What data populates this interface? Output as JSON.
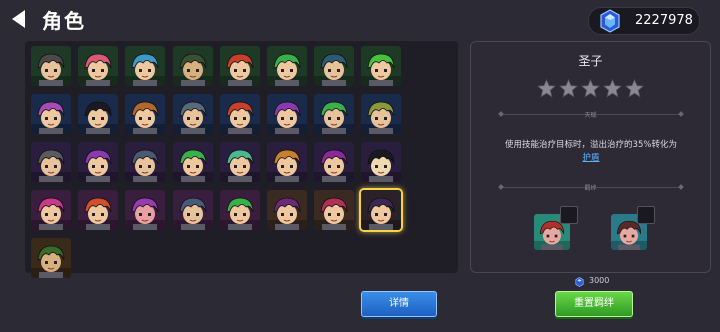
{
  "header": {
    "title": "角色",
    "currency_value": "2227978"
  },
  "roster": {
    "characters": [
      {
        "bg": "#1e3a26",
        "hair": "#4a4a4a",
        "skin": "#e8c29a"
      },
      {
        "bg": "#1e3a26",
        "hair": "#d85a78",
        "skin": "#f0c8a0"
      },
      {
        "bg": "#1e3a26",
        "hair": "#3a9ac8",
        "skin": "#f0c8a0"
      },
      {
        "bg": "#1e3a26",
        "hair": "#3a5030",
        "skin": "#d8b080"
      },
      {
        "bg": "#1e3a26",
        "hair": "#c8402c",
        "skin": "#f0c8a0"
      },
      {
        "bg": "#1e3a26",
        "hair": "#3ab04a",
        "skin": "#f0c8a0"
      },
      {
        "bg": "#1e3a26",
        "hair": "#2e5a74",
        "skin": "#e8c29a"
      },
      {
        "bg": "#1e3a26",
        "hair": "#48c040",
        "skin": "#f0c8a0"
      },
      {
        "bg": "#1a2a4a",
        "hair": "#a84ab8",
        "skin": "#f0c8a0"
      },
      {
        "bg": "#1a2a4a",
        "hair": "#1a1a22",
        "skin": "#f0c8a0"
      },
      {
        "bg": "#1a2a4a",
        "hair": "#b0682c",
        "skin": "#f0c8a0"
      },
      {
        "bg": "#1a2a4a",
        "hair": "#5a6a7a",
        "skin": "#e8c29a"
      },
      {
        "bg": "#1a2a4a",
        "hair": "#c8402c",
        "skin": "#f0c8a0"
      },
      {
        "bg": "#1a2a4a",
        "hair": "#8a3ab0",
        "skin": "#f0c8a0"
      },
      {
        "bg": "#1a2a4a",
        "hair": "#3ab04a",
        "skin": "#e8c29a"
      },
      {
        "bg": "#1a2a4a",
        "hair": "#8a9a3a",
        "skin": "#e8c29a"
      },
      {
        "bg": "#2a1e3e",
        "hair": "#5a5a62",
        "skin": "#e8c29a"
      },
      {
        "bg": "#2a1e3e",
        "hair": "#8a3ab0",
        "skin": "#f0c8a0"
      },
      {
        "bg": "#2a1e3e",
        "hair": "#4a5a74",
        "skin": "#e8c29a"
      },
      {
        "bg": "#2a1e3e",
        "hair": "#3ab04a",
        "skin": "#f0c8a0"
      },
      {
        "bg": "#2a1e3e",
        "hair": "#4ab890",
        "skin": "#f0c8a0"
      },
      {
        "bg": "#2a1e3e",
        "hair": "#c8802c",
        "skin": "#f0c8a0"
      },
      {
        "bg": "#2a1e3e",
        "hair": "#8a2a9a",
        "skin": "#f0c8a0"
      },
      {
        "bg": "#2a1e3e",
        "hair": "#1a1a22",
        "skin": "#f0d8b0"
      },
      {
        "bg": "#3a1e3e",
        "hair": "#c83a8a",
        "skin": "#f0c8a0"
      },
      {
        "bg": "#3a1e3e",
        "hair": "#d0502a",
        "skin": "#f0c8a0"
      },
      {
        "bg": "#3a1e3e",
        "hair": "#9a3ab0",
        "skin": "#e8a0a0"
      },
      {
        "bg": "#3a1e3e",
        "hair": "#4a5a7a",
        "skin": "#e8c29a"
      },
      {
        "bg": "#3a1e3e",
        "hair": "#3ab04a",
        "skin": "#f0c8a0"
      },
      {
        "bg": "#3a2a22",
        "hair": "#6a2a7a",
        "skin": "#f0c8a0"
      },
      {
        "bg": "#3a2a22",
        "hair": "#b0305a",
        "skin": "#f0c8a0"
      },
      {
        "bg": "#2a2228",
        "hair": "#3a2a52",
        "skin": "#f0c8a0",
        "selected": true
      },
      {
        "bg": "#3a2a1a",
        "hair": "#3a6a2a",
        "skin": "#d8b080"
      }
    ]
  },
  "detail": {
    "name": "圣子",
    "stars": 5,
    "section_skill": "天赋",
    "description_text": "使用技能治疗目标时，溢出治疗的35%转化为",
    "description_link": "护盾",
    "section_bond": "羁绊",
    "bonds": [
      {
        "bg": "#2a8a7a",
        "hair": "#b0302a"
      },
      {
        "bg": "#2a7a8a",
        "hair": "#5a2a2a"
      }
    ]
  },
  "footer": {
    "cost_value": "3000",
    "detail_button": "详情",
    "reset_button": "重置羁绊"
  },
  "colors": {
    "accent_blue": "#2a78d8",
    "accent_green": "#4ab83a",
    "selected_border": "#f5d34a",
    "link": "#5ab4ff"
  }
}
